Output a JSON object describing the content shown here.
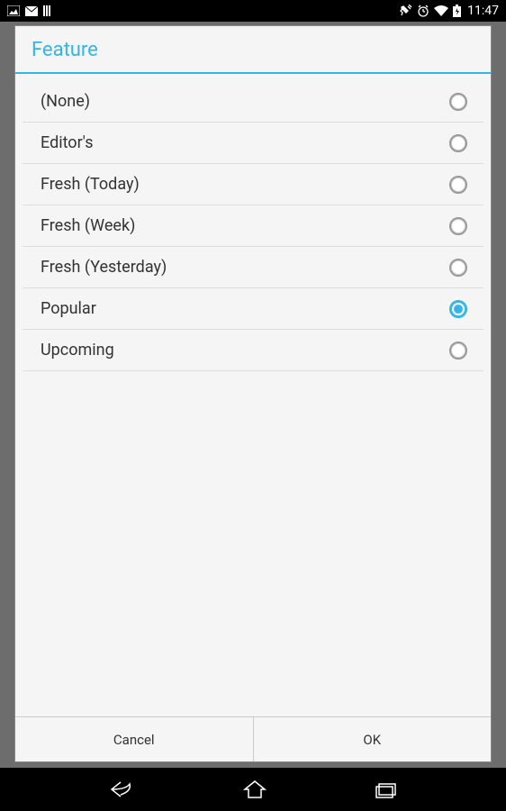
{
  "status": {
    "time": "11:47"
  },
  "dialog": {
    "title": "Feature",
    "options": [
      {
        "label": "(None)",
        "selected": false
      },
      {
        "label": "Editor's",
        "selected": false
      },
      {
        "label": "Fresh (Today)",
        "selected": false
      },
      {
        "label": "Fresh (Week)",
        "selected": false
      },
      {
        "label": "Fresh (Yesterday)",
        "selected": false
      },
      {
        "label": "Popular",
        "selected": true
      },
      {
        "label": "Upcoming",
        "selected": false
      }
    ],
    "buttons": {
      "cancel": "Cancel",
      "ok": "OK"
    }
  }
}
